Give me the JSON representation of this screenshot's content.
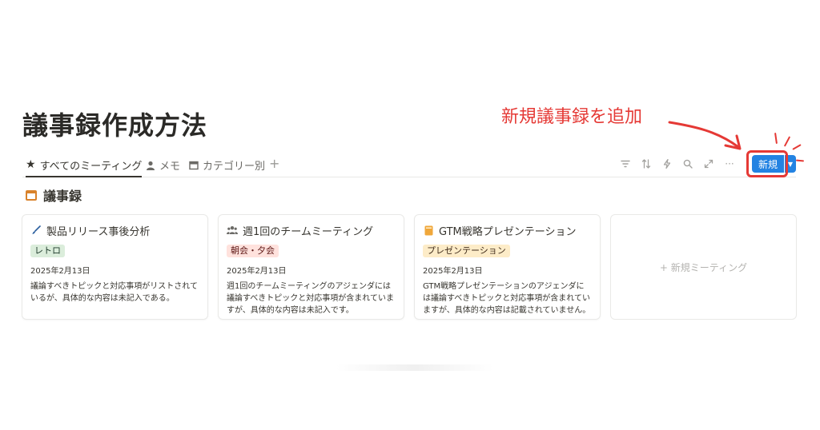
{
  "page": {
    "title": "議事録作成方法"
  },
  "annotation": {
    "text": "新規議事録を追加",
    "color": "#e53935"
  },
  "tabs": [
    {
      "label": "すべてのミーティング",
      "icon": "star-icon"
    },
    {
      "label": "メモ",
      "icon": "person-icon"
    },
    {
      "label": "カテゴリー別",
      "icon": "table-icon"
    }
  ],
  "toolbar": {
    "icons": [
      "filter-icon",
      "sort-icon",
      "automation-icon",
      "search-icon",
      "expand-icon",
      "more-icon"
    ],
    "new_label": "新規",
    "accent": "#2383e2"
  },
  "section": {
    "title": "議事録",
    "icon": "calendar-icon"
  },
  "cards": [
    {
      "title": "製品リリース事後分析",
      "icon": "brush-icon",
      "tag": "レトロ",
      "tag_bg": "#dbeddb",
      "tag_fg": "#1c3829",
      "date": "2025年2月13日",
      "description": "議論すべきトピックと対応事項がリストされているが、具体的な内容は未記入である。"
    },
    {
      "title": "週1回のチームミーティング",
      "icon": "people-icon",
      "tag": "朝会・夕会",
      "tag_bg": "#ffe2dd",
      "tag_fg": "#5d1715",
      "date": "2025年2月13日",
      "description": "週1回のチームミーティングのアジェンダには議論すべきトピックと対応事項が含まれていますが、具体的な内容は未記入です。"
    },
    {
      "title": "GTM戦略プレゼンテーション",
      "icon": "book-icon",
      "tag": "プレゼンテーション",
      "tag_bg": "#fdecc8",
      "tag_fg": "#402c1b",
      "date": "2025年2月13日",
      "description": "GTM戦略プレゼンテーションのアジェンダには議論すべきトピックと対応事項が含まれていますが、具体的な内容は記載されていません。"
    }
  ],
  "new_card": {
    "label": "+ 新規ミーティング"
  }
}
